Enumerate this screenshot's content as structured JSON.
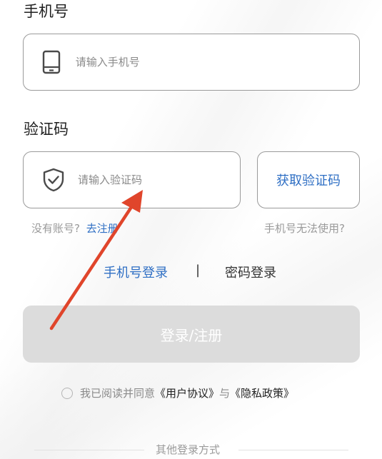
{
  "phone_section": {
    "label": "手机号",
    "input_placeholder": "请输入手机号",
    "icon": "phone-icon"
  },
  "code_section": {
    "label": "验证码",
    "input_placeholder": "请输入验证码",
    "icon": "shield-check-icon",
    "get_code_label": "获取验证码"
  },
  "hints": {
    "no_account": "没有账号?",
    "register_link": "去注册",
    "phone_unavailable": "手机号无法使用?"
  },
  "login_switch": {
    "phone_login": "手机号登录",
    "separator": "|",
    "password_login": "密码登录"
  },
  "submit_label": "登录/注册",
  "agreement": {
    "prefix": "我已阅读并同意",
    "user_agreement": "《用户协议》",
    "connector": "与",
    "privacy_policy": "《隐私政策》"
  },
  "other_login_label": "其他登录方式",
  "colors": {
    "link": "#2f6fc4",
    "submit_disabled": "#dcdcdc",
    "annotation_arrow": "#e0452b"
  }
}
